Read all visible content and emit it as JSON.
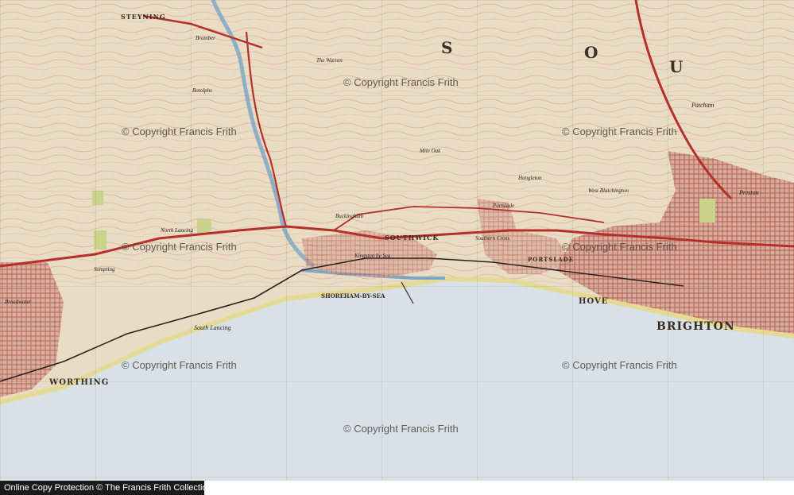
{
  "map": {
    "towns": [
      {
        "id": "brighton",
        "name": "BRIGHTON"
      },
      {
        "id": "hove",
        "name": "HOVE"
      },
      {
        "id": "worthing",
        "name": "WORTHING"
      },
      {
        "id": "southwick",
        "name": "SOUTHWICK"
      },
      {
        "id": "shoreham",
        "name": "SHOREHAM-BY-SEA"
      },
      {
        "id": "portslade",
        "name": "PORTSLADE"
      },
      {
        "id": "portslade2",
        "name": "Portslade"
      },
      {
        "id": "south-lancing",
        "name": "South Lancing"
      },
      {
        "id": "patcham",
        "name": "Patcham"
      },
      {
        "id": "preston",
        "name": "Preston"
      },
      {
        "id": "steyning",
        "name": "STEYNING"
      },
      {
        "id": "bramber",
        "name": "Bramber"
      },
      {
        "id": "kingston",
        "name": "Kingston by Sea"
      },
      {
        "id": "hangleton",
        "name": "Hangleton"
      },
      {
        "id": "west-blatchington",
        "name": "West Blatchington"
      },
      {
        "id": "southern-cross",
        "name": "Southern Cross"
      },
      {
        "id": "sompting",
        "name": "Sompting"
      },
      {
        "id": "broadwater",
        "name": "Broadwater"
      },
      {
        "id": "north-lancing",
        "name": "North Lancing"
      },
      {
        "id": "botolphs",
        "name": "Botolphs"
      },
      {
        "id": "buckingham",
        "name": "Buckingham"
      },
      {
        "id": "mile-oak",
        "name": "Mile Oak"
      },
      {
        "id": "the-warren",
        "name": "The Warren"
      }
    ],
    "big_letters": [
      {
        "id": "s",
        "text": "S"
      },
      {
        "id": "o",
        "text": "O"
      },
      {
        "id": "u",
        "text": "U"
      }
    ],
    "watermarks": [
      "© Copyright Francis Frith",
      "© Copyright Francis Frith",
      "© Copyright Francis Frith",
      "© Copyright Francis Frith",
      "© Copyright Francis Frith",
      "© Copyright Francis Frith",
      "© Copyright Francis Frith"
    ],
    "footer_text": "Online Copy Protection © The Francis Frith Collection",
    "colors": {
      "land": "#e9dcc4",
      "sea": "#d8e2e6",
      "contour": "#d98c6c",
      "road": "#b5302a",
      "river": "#7fa7c4",
      "urban": "#b86a5c",
      "beach": "#e6d98c",
      "woods": "#c9d48a"
    }
  }
}
